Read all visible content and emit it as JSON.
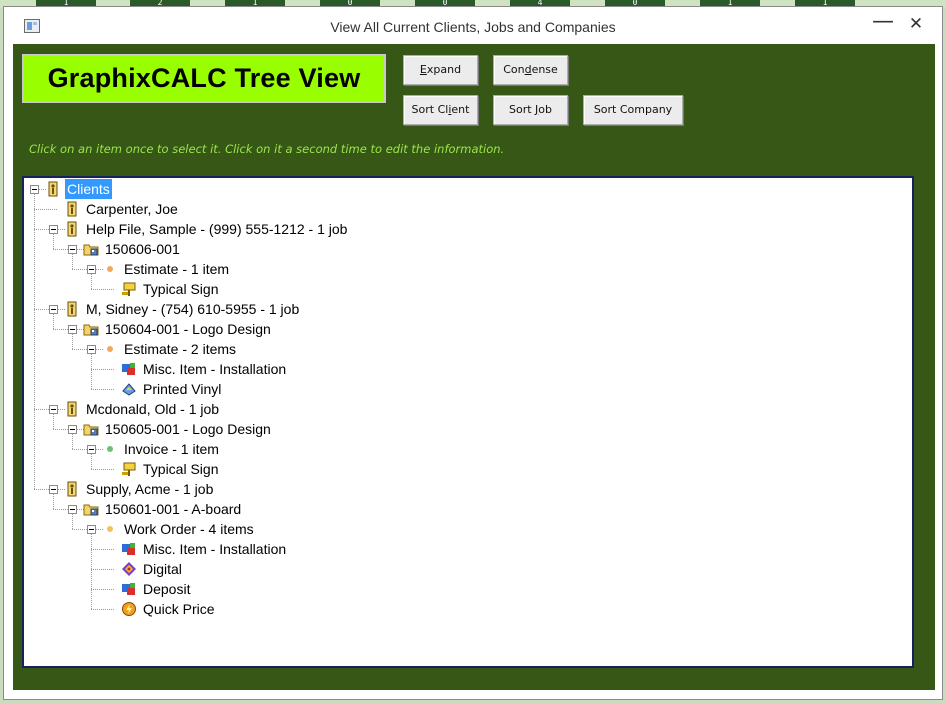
{
  "background_tabs": [
    "1",
    "2",
    "1",
    "0",
    "0",
    "4",
    "0",
    "1",
    "1"
  ],
  "window": {
    "title": "View All Current Clients, Jobs and Companies",
    "minimize_glyph": "—",
    "close_glyph": "✕"
  },
  "banner": {
    "text": "GraphixCALC Tree View",
    "color": "#99ff00"
  },
  "buttons": {
    "expand": {
      "pre": "",
      "u": "E",
      "post": "xpand"
    },
    "condense": {
      "pre": "Con",
      "u": "d",
      "post": "ense"
    },
    "sort_client": {
      "pre": "Sort Cl",
      "u": "i",
      "post": "ent"
    },
    "sort_job": {
      "pre": "Sort ",
      "u": "J",
      "post": "ob"
    },
    "sort_company": {
      "pre": "Sort Company",
      "u": "",
      "post": ""
    }
  },
  "hint": "Click on an item once to select it. Click on it a second time to edit the information.",
  "colors": {
    "panel_bg": "#375717",
    "hint_text": "#9be64a",
    "selection": "#3399ff",
    "tree_border": "#14235e"
  },
  "tree": [
    {
      "label": "Clients",
      "level": 0,
      "icon": "client-icon",
      "expander": true,
      "selected": true
    },
    {
      "label": "Carpenter, Joe",
      "level": 1,
      "icon": "client-icon",
      "expander": false
    },
    {
      "label": "Help File, Sample - (999) 555-1212 - 1 job",
      "level": 1,
      "icon": "client-icon",
      "expander": true
    },
    {
      "label": "150606-001",
      "level": 2,
      "icon": "job-folder-icon",
      "expander": true
    },
    {
      "label": "Estimate - 1 item",
      "level": 3,
      "icon": "estimate-dot-icon",
      "expander": true
    },
    {
      "label": "Typical Sign",
      "level": 4,
      "icon": "sign-icon",
      "expander": false
    },
    {
      "label": "M, Sidney - (754) 610-5955 - 1 job",
      "level": 1,
      "icon": "client-icon",
      "expander": true
    },
    {
      "label": "150604-001 - Logo Design",
      "level": 2,
      "icon": "job-folder-icon",
      "expander": true
    },
    {
      "label": "Estimate - 2 items",
      "level": 3,
      "icon": "estimate-dot-icon",
      "expander": true
    },
    {
      "label": "Misc. Item - Installation",
      "level": 4,
      "icon": "misc-item-icon",
      "expander": false
    },
    {
      "label": "Printed Vinyl",
      "level": 4,
      "icon": "vinyl-icon",
      "expander": false
    },
    {
      "label": "Mcdonald, Old - 1 job",
      "level": 1,
      "icon": "client-icon",
      "expander": true
    },
    {
      "label": "150605-001 - Logo Design",
      "level": 2,
      "icon": "job-folder-icon",
      "expander": true
    },
    {
      "label": "Invoice - 1 item",
      "level": 3,
      "icon": "invoice-dot-icon",
      "expander": true
    },
    {
      "label": "Typical Sign",
      "level": 4,
      "icon": "sign-icon",
      "expander": false
    },
    {
      "label": "Supply, Acme - 1 job",
      "level": 1,
      "icon": "client-icon",
      "expander": true
    },
    {
      "label": "150601-001 - A-board",
      "level": 2,
      "icon": "job-folder-icon",
      "expander": true
    },
    {
      "label": "Work Order - 4 items",
      "level": 3,
      "icon": "workorder-dot-icon",
      "expander": true
    },
    {
      "label": "Misc. Item - Installation",
      "level": 4,
      "icon": "misc-item-icon",
      "expander": false
    },
    {
      "label": "Digital",
      "level": 4,
      "icon": "digital-icon",
      "expander": false
    },
    {
      "label": "Deposit",
      "level": 4,
      "icon": "deposit-icon",
      "expander": false
    },
    {
      "label": "Quick Price",
      "level": 4,
      "icon": "quick-price-icon",
      "expander": false
    }
  ]
}
